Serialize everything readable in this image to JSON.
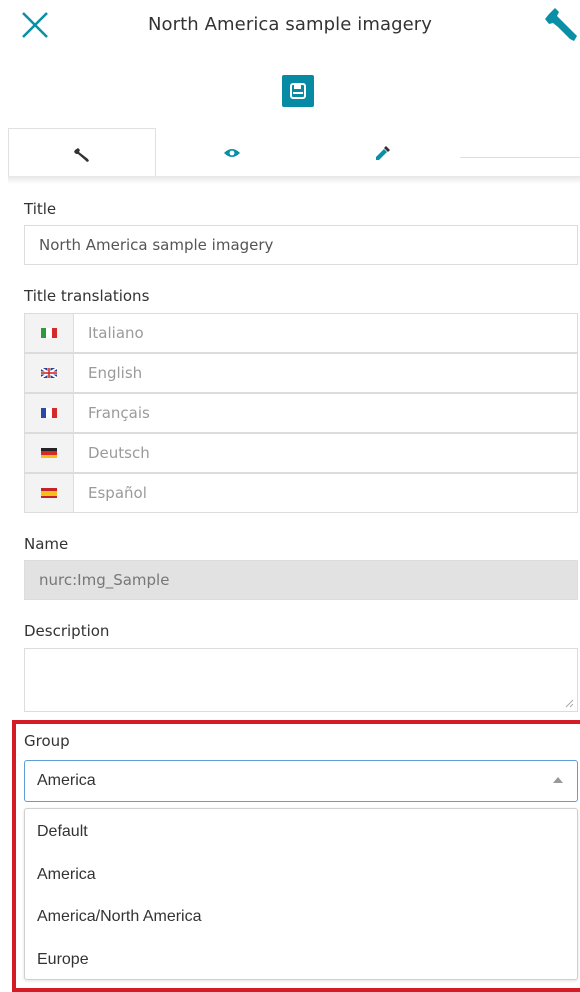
{
  "header": {
    "title": "North America sample imagery"
  },
  "tabs": [
    {
      "icon": "wrench-icon"
    },
    {
      "icon": "eye-icon"
    },
    {
      "icon": "eyedropper-icon"
    }
  ],
  "form": {
    "title_label": "Title",
    "title_value": "North America sample imagery",
    "translations_label": "Title translations",
    "translations": [
      {
        "lang": "it",
        "placeholder": "Italiano"
      },
      {
        "lang": "en",
        "placeholder": "English"
      },
      {
        "lang": "fr",
        "placeholder": "Français"
      },
      {
        "lang": "de",
        "placeholder": "Deutsch"
      },
      {
        "lang": "es",
        "placeholder": "Español"
      }
    ],
    "name_label": "Name",
    "name_value": "nurc:Img_Sample",
    "description_label": "Description",
    "description_value": "",
    "group_label": "Group",
    "group_selected": "America",
    "group_options": [
      "Default",
      "America",
      "America/North America",
      "Europe"
    ]
  },
  "colors": {
    "accent": "#078aa3",
    "highlight_box": "#d41c27",
    "select_border": "#5f9ed6"
  }
}
